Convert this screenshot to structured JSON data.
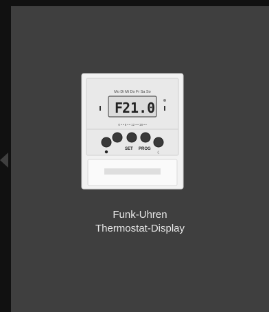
{
  "product": {
    "display_value": "21.0",
    "display_prefix": "F",
    "weekday_labels": "Mo Di Mi Do Fr Sa So",
    "button_set_label": "SET",
    "button_prog_label": "PROG",
    "icon": "thermostat-display-product-image"
  },
  "caption": {
    "line1": "Funk-Uhren",
    "line2": "Thermostat-Display"
  },
  "colors": {
    "page_background": "#111111",
    "tile_background": "#3f3f3f",
    "caption_text": "#e6e6e6"
  }
}
